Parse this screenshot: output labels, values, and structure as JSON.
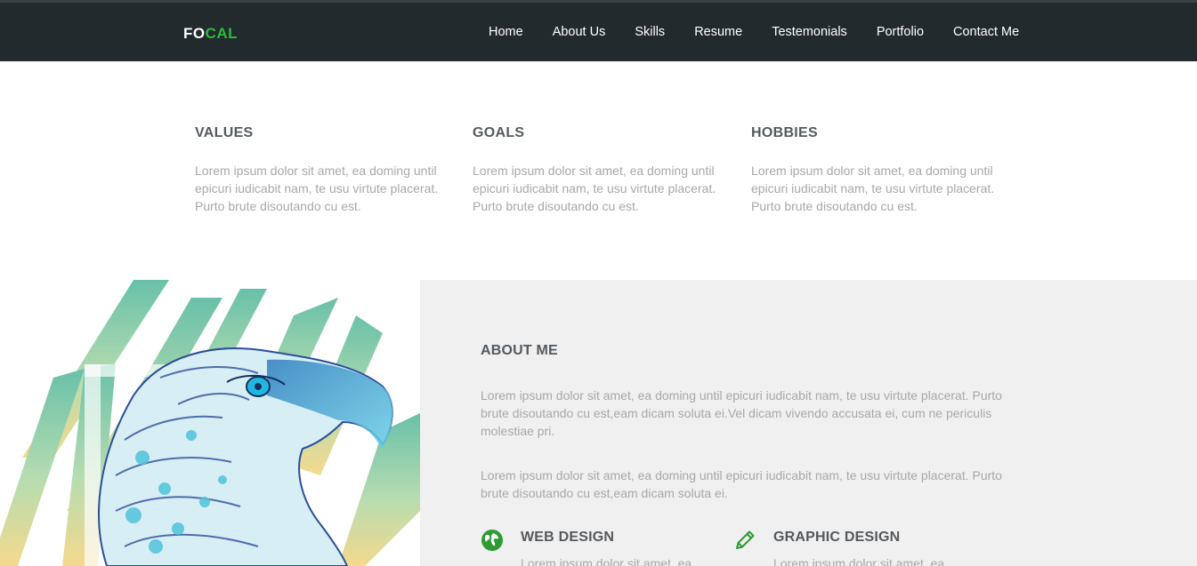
{
  "header": {
    "logo_prefix": "FO",
    "logo_accent": "CAL",
    "nav": [
      "Home",
      "About Us",
      "Skills",
      "Resume",
      "Testemonials",
      "Portfolio",
      "Contact Me"
    ]
  },
  "values": {
    "columns": [
      {
        "title": "VALUES",
        "text": "Lorem ipsum dolor sit amet, ea doming until epicuri iudicabit nam, te usu virtute placerat. Purto brute disoutando cu est."
      },
      {
        "title": "GOALS",
        "text": "Lorem ipsum dolor sit amet, ea doming until epicuri iudicabit nam, te usu virtute placerat. Purto brute disoutando cu est."
      },
      {
        "title": "HOBBIES",
        "text": "Lorem ipsum dolor sit amet, ea doming until epicuri iudicabit nam, te usu virtute placerat. Purto brute disoutando cu est."
      }
    ]
  },
  "about": {
    "title": "ABOUT ME",
    "paragraphs": [
      "Lorem ipsum dolor sit amet, ea doming until epicuri iudicabit nam, te usu virtute placerat. Purto brute disoutando cu est,eam dicam soluta ei.Vel dicam vivendo accusata ei, cum ne periculis molestiae pri.",
      "Lorem ipsum dolor sit amet, ea doming until epicuri iudicabit nam, te usu virtute placerat. Purto brute disoutando cu est,eam dicam soluta ei."
    ],
    "services": [
      {
        "icon": "globe-icon",
        "title": "WEB DESIGN",
        "text": "Lorem ipsum dolor sit amet, ea"
      },
      {
        "icon": "pencil-icon",
        "title": "GRAPHIC DESIGN",
        "text": "Lorem ipsum dolor sit amet, ea"
      }
    ]
  },
  "colors": {
    "navbar_bg": "#232a2e",
    "accent": "#2fba3c",
    "heading": "#555a5e",
    "body_text": "#a8a8a8",
    "panel_bg": "#f0f0f0"
  }
}
